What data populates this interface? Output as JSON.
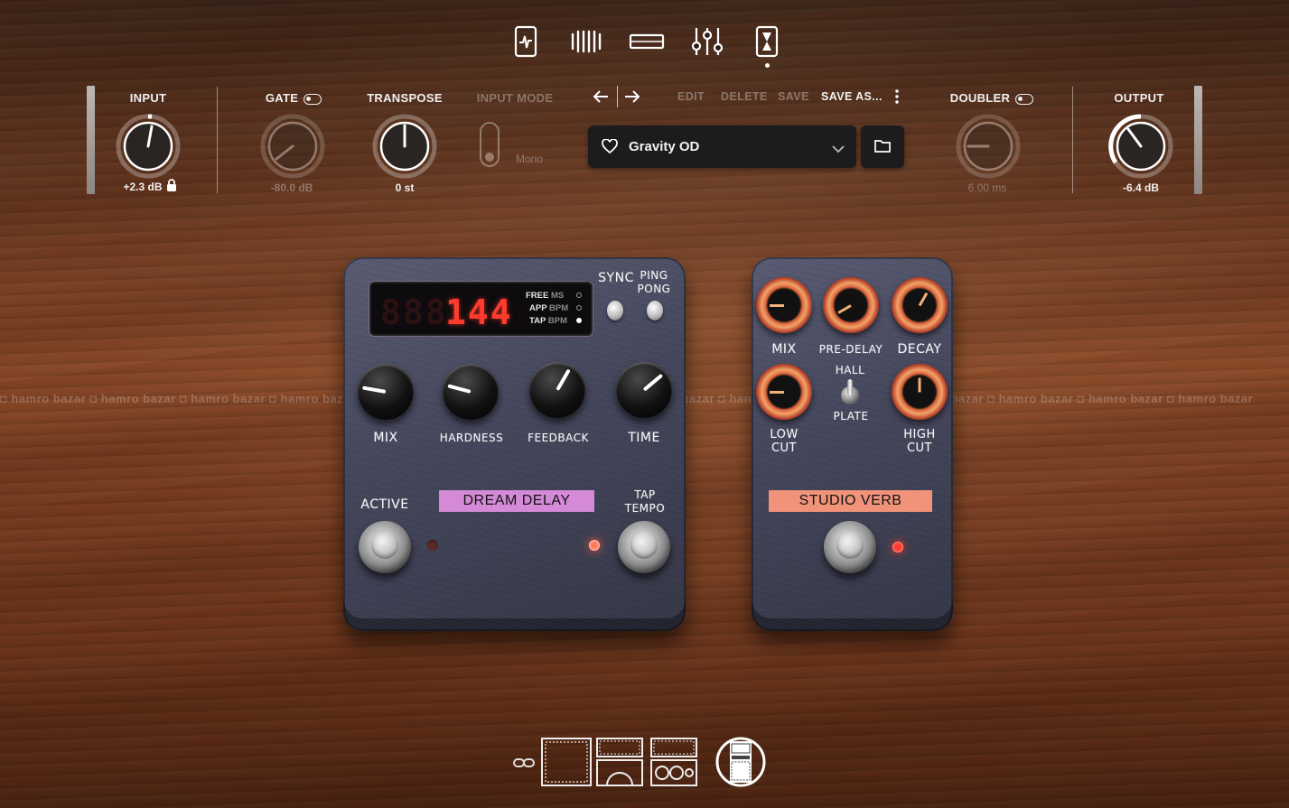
{
  "nav": {
    "tabs": [
      {
        "name": "pedal-tab-icon"
      },
      {
        "name": "amp-tab-icon"
      },
      {
        "name": "cabinet-tab-icon"
      },
      {
        "name": "mixer-tab-icon"
      },
      {
        "name": "effects-tab-icon",
        "active": true
      }
    ]
  },
  "input": {
    "label": "INPUT",
    "value": "+2.3 dB"
  },
  "gate": {
    "label": "GATE",
    "value": "-80.0 dB"
  },
  "transpose": {
    "label": "TRANSPOSE",
    "value": "0 st"
  },
  "input_mode": {
    "label": "INPUT MODE",
    "value": "Mono"
  },
  "preset": {
    "edit": "EDIT",
    "delete": "DELETE",
    "save": "SAVE",
    "save_as": "SAVE AS...",
    "name": "Gravity OD"
  },
  "doubler": {
    "label": "DOUBLER",
    "value": "6.00 ms"
  },
  "output": {
    "label": "OUTPUT",
    "value": "-6.4 dB"
  },
  "dream_delay": {
    "name": "DREAM DELAY",
    "display": "144",
    "modes": [
      {
        "label": "FREE",
        "unit": "MS",
        "active": false
      },
      {
        "label": "APP",
        "unit": "BPM",
        "active": false
      },
      {
        "label": "TAP",
        "unit": "BPM",
        "active": true
      }
    ],
    "sync_label": "SYNC",
    "ping_pong_label": "PING PONG",
    "knobs": [
      "MIX",
      "HARDNESS",
      "FEEDBACK",
      "TIME"
    ],
    "active_label": "ACTIVE",
    "tap_tempo_label": "TAP TEMPO",
    "strip_color": "#d48ad6"
  },
  "studio_verb": {
    "name": "STUDIO VERB",
    "knobs_top": [
      "MIX",
      "PRE-DELAY",
      "DECAY"
    ],
    "switch_top": "HALL",
    "switch_bottom": "PLATE",
    "low_cut": "LOW CUT",
    "high_cut": "HIGH CUT",
    "strip_color": "#f0937a"
  },
  "watermark": "hamro bazar",
  "colors": {
    "led_red": "#ff3b2f",
    "segment_red": "#ff3a2e"
  }
}
